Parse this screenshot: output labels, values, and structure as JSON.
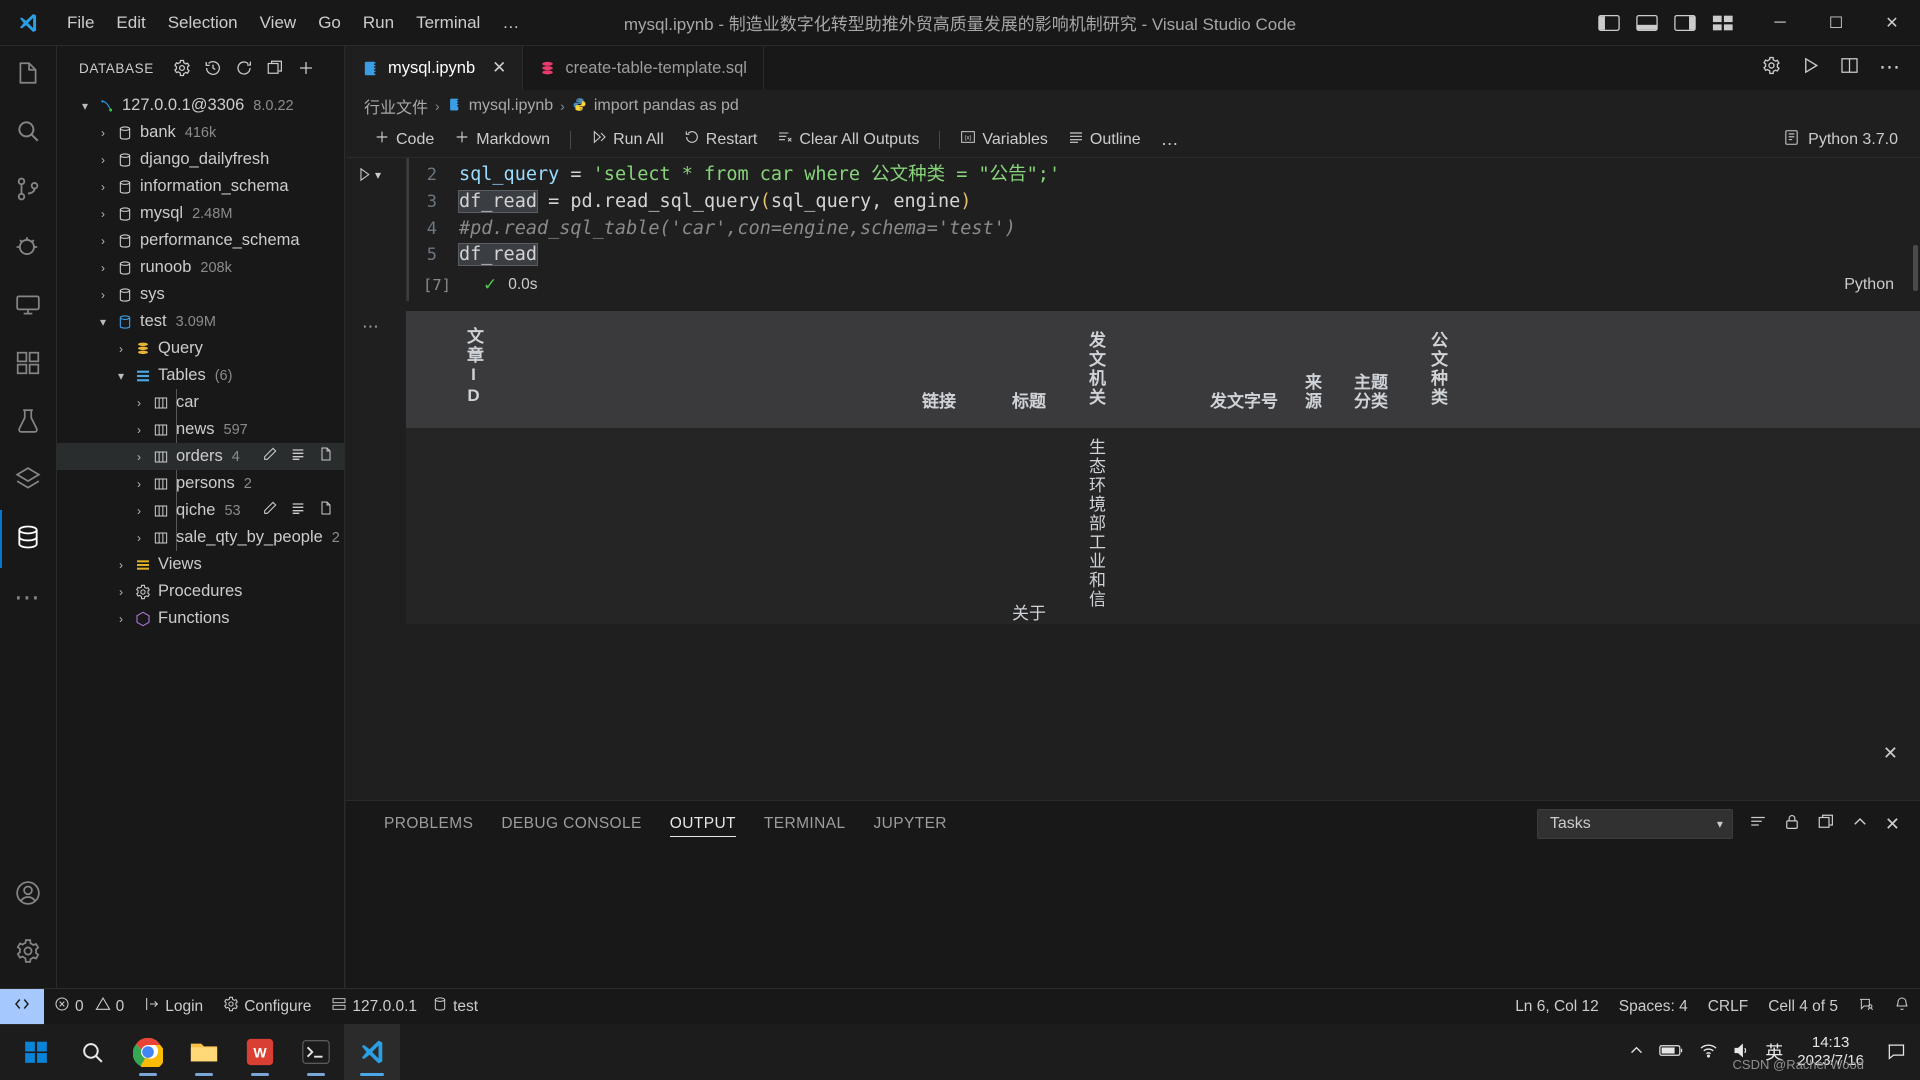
{
  "titlebar": {
    "menus": [
      "File",
      "Edit",
      "Selection",
      "View",
      "Go",
      "Run",
      "Terminal",
      "…"
    ],
    "title": "mysql.ipynb - 制造业数字化转型助推外贸高质量发展的影响机制研究 - Visual Studio Code",
    "minimize": "─",
    "maximize": "☐",
    "close": "✕"
  },
  "activitybar": {
    "items": [
      {
        "name": "explorer",
        "icon": "files-icon"
      },
      {
        "name": "search",
        "icon": "search-icon"
      },
      {
        "name": "source-control",
        "icon": "source-control-icon"
      },
      {
        "name": "run-debug",
        "icon": "run-debug-icon"
      },
      {
        "name": "remote-explorer",
        "icon": "remote-explorer-icon"
      },
      {
        "name": "extensions",
        "icon": "extensions-icon"
      },
      {
        "name": "testing",
        "icon": "beaker-icon"
      },
      {
        "name": "layers",
        "icon": "layers-icon"
      },
      {
        "name": "database",
        "icon": "database-icon"
      },
      {
        "name": "more",
        "icon": "ellipsis-icon"
      }
    ],
    "bottom": [
      {
        "name": "accounts",
        "icon": "account-icon"
      },
      {
        "name": "settings",
        "icon": "gear-icon"
      }
    ]
  },
  "sidebar": {
    "title": "DATABASE",
    "actions": [
      "gear-icon",
      "history-icon",
      "refresh-icon",
      "new-window-icon",
      "add-icon"
    ],
    "connection": {
      "label": "127.0.0.1@3306",
      "version": "8.0.22",
      "expanded": true
    },
    "databases": [
      {
        "label": "bank",
        "size": "416k",
        "indent": 1
      },
      {
        "label": "django_dailyfresh",
        "size": "",
        "indent": 1
      },
      {
        "label": "information_schema",
        "size": "",
        "indent": 1
      },
      {
        "label": "mysql",
        "size": "2.48M",
        "indent": 1
      },
      {
        "label": "performance_schema",
        "size": "",
        "indent": 1
      },
      {
        "label": "runoob",
        "size": "208k",
        "indent": 1
      },
      {
        "label": "sys",
        "size": "",
        "indent": 1
      }
    ],
    "test_db": {
      "label": "test",
      "size": "3.09M"
    },
    "query_label": "Query",
    "tables_label": "Tables",
    "tables_count": "(6)",
    "tables": [
      {
        "label": "car",
        "count": "",
        "selected": false,
        "actions": false
      },
      {
        "label": "news",
        "count": "597",
        "selected": false,
        "actions": false
      },
      {
        "label": "orders",
        "count": "4",
        "selected": true,
        "actions": true
      },
      {
        "label": "persons",
        "count": "2",
        "selected": false,
        "actions": false
      },
      {
        "label": "qiche",
        "count": "53",
        "selected": false,
        "actions": true
      },
      {
        "label": "sale_qty_by_people",
        "count": "2",
        "selected": false,
        "actions": false
      }
    ],
    "groups": [
      {
        "label": "Views",
        "icon": "views-icon"
      },
      {
        "label": "Procedures",
        "icon": "procedures-icon"
      },
      {
        "label": "Functions",
        "icon": "functions-icon"
      }
    ]
  },
  "editor": {
    "tabs": [
      {
        "label": "mysql.ipynb",
        "icon": "notebook-icon",
        "active": true,
        "closable": true
      },
      {
        "label": "create-table-template.sql",
        "icon": "sql-icon",
        "active": false,
        "closable": false
      }
    ],
    "tab_actions": [
      "gear-icon",
      "run-icon",
      "split-editor-icon",
      "ellipsis-icon"
    ],
    "breadcrumb": [
      {
        "label": "行业文件",
        "icon": "folder-icon"
      },
      {
        "label": "mysql.ipynb",
        "icon": "notebook-icon"
      },
      {
        "label": "import pandas as pd",
        "icon": "python-icon"
      }
    ],
    "toolbar": {
      "code": "Code",
      "markdown": "Markdown",
      "run_all": "Run All",
      "restart": "Restart",
      "clear_outputs": "Clear All Outputs",
      "variables": "Variables",
      "outline": "Outline",
      "more": "…",
      "kernel": "Python 3.7.0"
    }
  },
  "cell": {
    "lines": [
      {
        "num": "2",
        "text": "sql_query = 'select * from car where 公文种类 = \"公告\";'"
      },
      {
        "num": "3",
        "text": "df_read = pd.read_sql_query(sql_query, engine)"
      },
      {
        "num": "4",
        "text": "#pd.read_sql_table('car',con=engine,schema='test')"
      },
      {
        "num": "5",
        "text": "df_read"
      }
    ],
    "exec_count": "[7]",
    "exec_time": "0.0s",
    "status_icon": "check-icon",
    "language": "Python"
  },
  "output_table": {
    "headers": [
      "文章ID",
      "链接",
      "标题",
      "发文机关",
      "发文字号",
      "来源",
      "主题分类",
      "公文种类"
    ],
    "rows": [
      {
        "文章ID": "",
        "链接": "",
        "标题": "关于",
        "发文机关": "生态环境部工业和信",
        "发文字号": "",
        "来源": "",
        "主题分类": "",
        "公文种类": ""
      }
    ]
  },
  "panel": {
    "tabs": [
      "PROBLEMS",
      "DEBUG CONSOLE",
      "OUTPUT",
      "TERMINAL",
      "JUPYTER"
    ],
    "active_tab": "OUTPUT",
    "select_value": "Tasks",
    "actions": [
      "clear-output-icon",
      "lock-icon",
      "new-terminal-icon",
      "chevron-up-icon",
      "close-icon"
    ],
    "close_label": "✕"
  },
  "statusbar": {
    "remote_icon": "remote-icon",
    "errors": "0",
    "warnings": "0",
    "login": "Login",
    "configure": "Configure",
    "host": "127.0.0.1",
    "database": "test",
    "position": "Ln 6, Col 12",
    "spaces": "Spaces: 4",
    "eol": "CRLF",
    "cell": "Cell 4 of 5",
    "feedback_icon": "feedback-icon",
    "bell_icon": "bell-icon"
  },
  "taskbar": {
    "items": [
      {
        "name": "start-button",
        "icon": "windows-icon"
      },
      {
        "name": "search-button",
        "icon": "search-icon"
      },
      {
        "name": "chrome-app",
        "icon": "chrome-icon",
        "running": true
      },
      {
        "name": "file-explorer-app",
        "icon": "folder-icon",
        "running": true
      },
      {
        "name": "wps-app",
        "icon": "wps-icon",
        "running": true
      },
      {
        "name": "terminal-app",
        "icon": "terminal-icon",
        "running": true
      },
      {
        "name": "vscode-app",
        "icon": "vscode-icon",
        "running": true,
        "active": true
      }
    ],
    "tray": [
      "chevron-up-icon",
      "battery-icon",
      "wifi-icon",
      "volume-icon"
    ],
    "ime": "英",
    "time": "14:13",
    "date": "2023/7/16",
    "watermark": "CSDN @Rachel Wood"
  },
  "colors": {
    "accent": "#0078d4",
    "titlebar_bg": "#181818",
    "editor_bg": "#1f1f1f",
    "sidebar_bg": "#181818",
    "table_header_bg": "#3a3a3c",
    "table_body_bg": "#252526",
    "success": "#4ec94e",
    "string": "#87d47a"
  }
}
